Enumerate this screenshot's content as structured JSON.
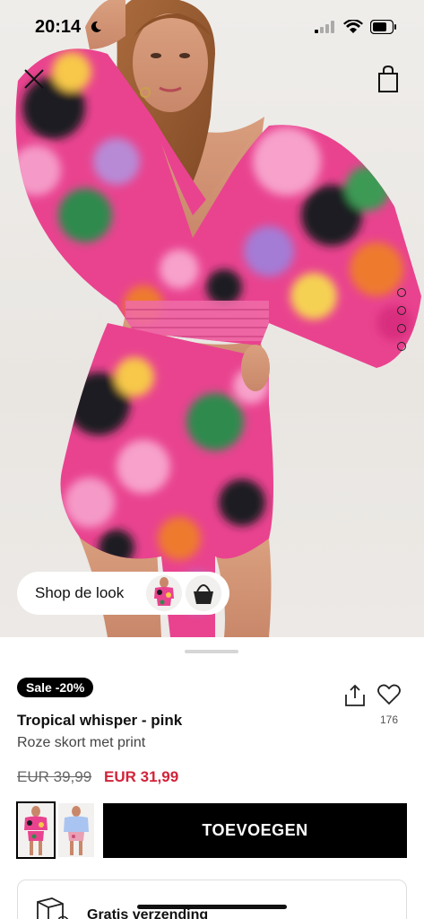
{
  "status_bar": {
    "time": "20:14"
  },
  "hero": {
    "image_alt": "Model wearing pink floral printed smocked top and matching skort",
    "carousel_dot_count": 4
  },
  "shop_the_look": {
    "label": "Shop de look"
  },
  "product": {
    "badge": "Sale -20%",
    "name": "Tropical whisper - pink",
    "subtitle": "Roze skort met print",
    "price_old": "EUR 39,99",
    "price_new": "EUR 31,99",
    "like_count": "176",
    "add_button": "TOEVOEGEN"
  },
  "shipping": {
    "label": "Gratis verzending"
  },
  "colors": {
    "sale_red": "#d2233a",
    "black": "#000000",
    "accent_pink": "#ec5aa3"
  },
  "icons": [
    "close-icon",
    "shopping-bag-icon",
    "share-icon",
    "heart-icon",
    "truck-icon",
    "wifi-icon",
    "battery-icon",
    "moon-icon"
  ]
}
